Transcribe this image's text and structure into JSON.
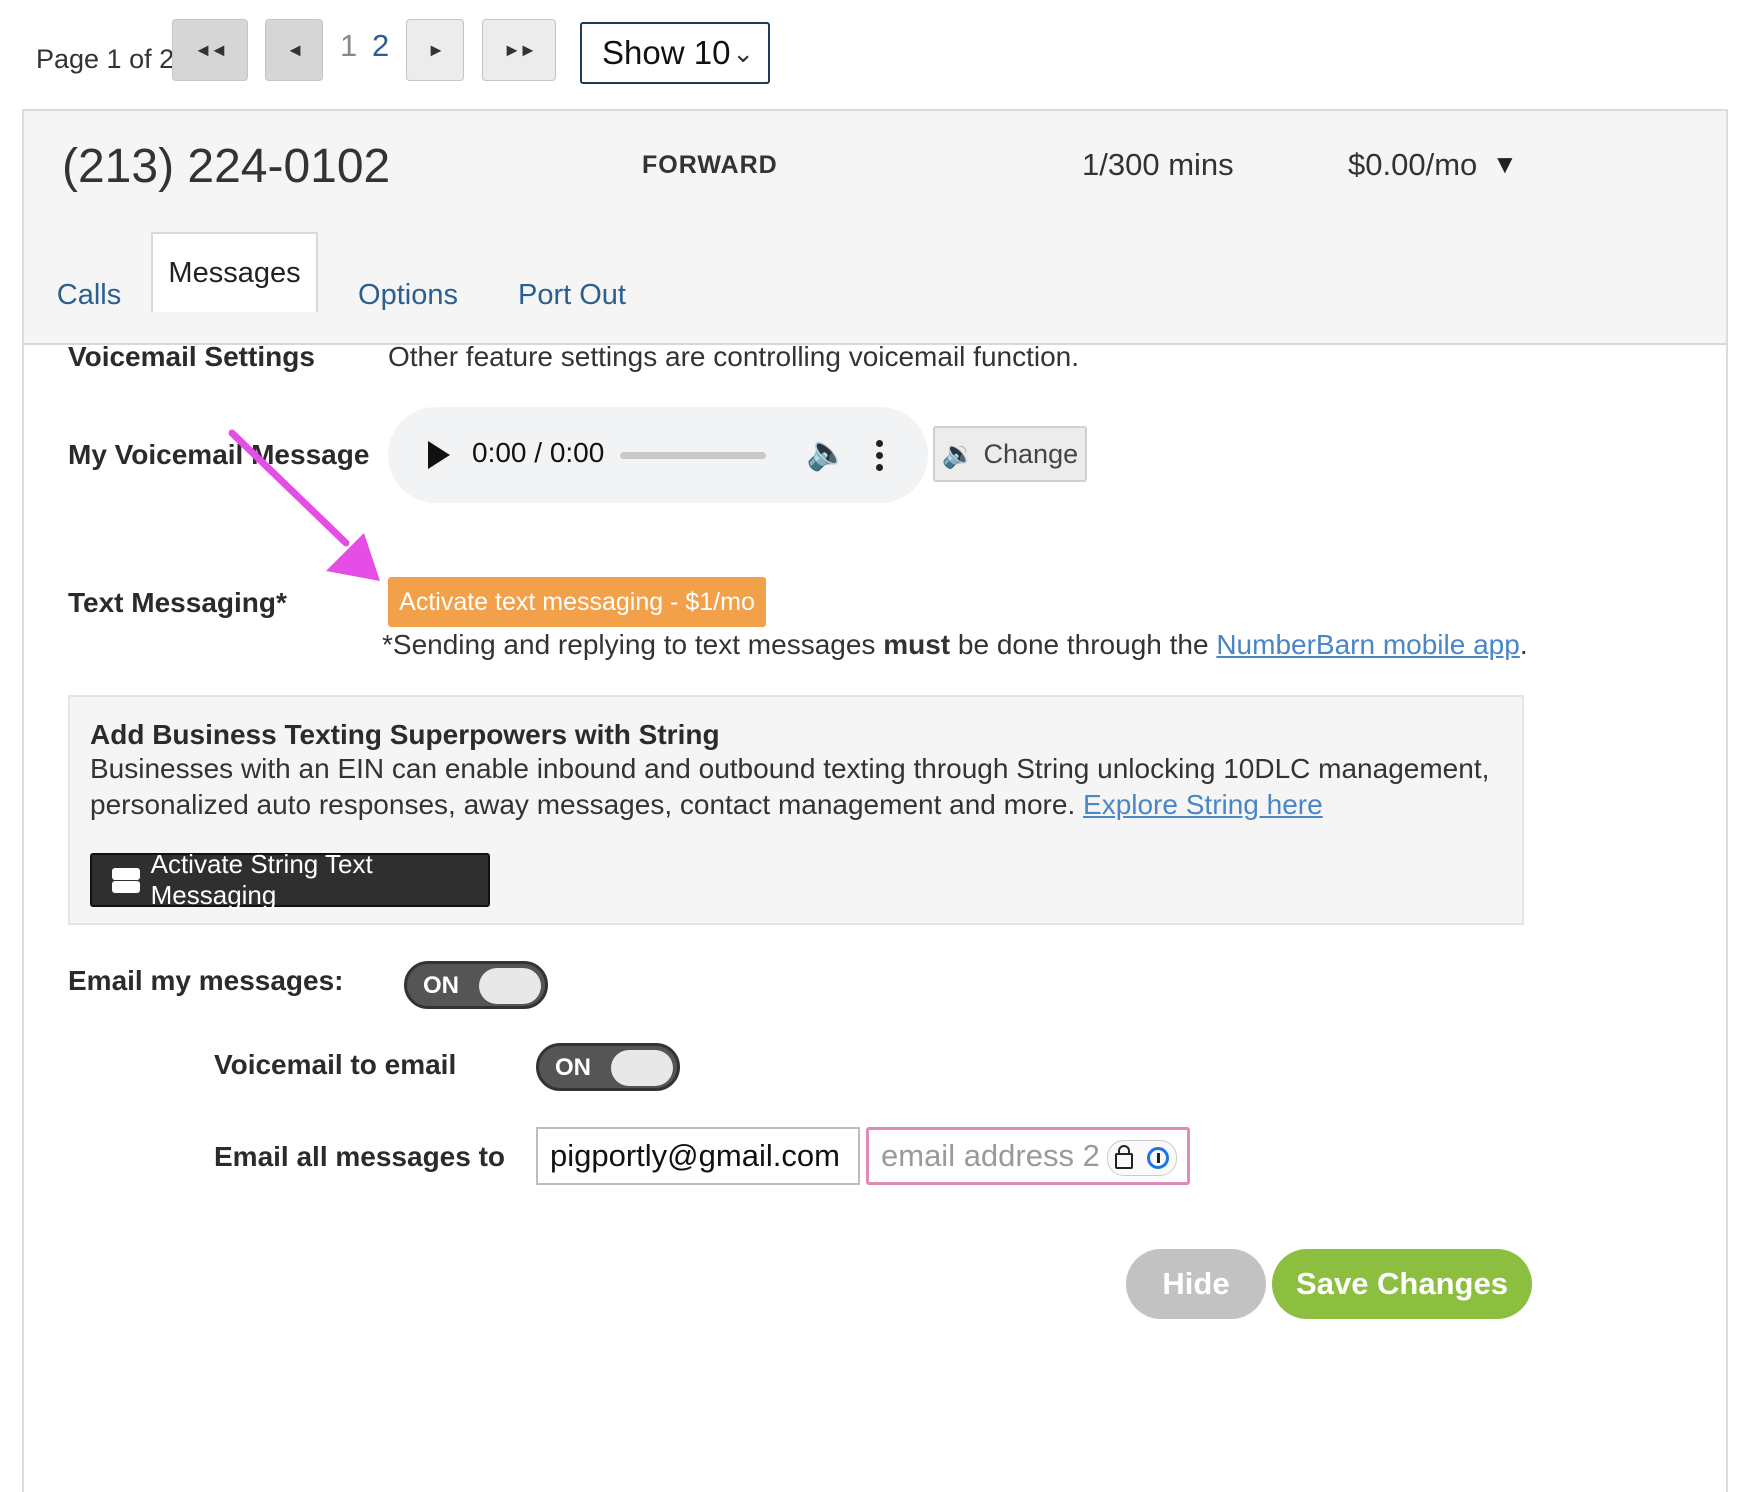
{
  "pagination": {
    "page_info": "Page 1 of 2",
    "first_label": "◄◄",
    "prev_label": "◄",
    "page1": "1",
    "page2": "2",
    "next_label": "►",
    "last_label": "►►",
    "show_select": "Show 10"
  },
  "number": {
    "phone": "(213) 224-0102",
    "mode": "FORWARD",
    "usage": "1/300 mins",
    "price": "$0.00/mo",
    "caret": "▼"
  },
  "tabs": [
    "Calls",
    "Messages",
    "Options",
    "Port Out"
  ],
  "voicemail": {
    "settings_label": "Voicemail Settings",
    "settings_text": "Other feature settings are controlling voicemail function.",
    "message_label": "My Voicemail Message",
    "player_time": "0:00 / 0:00",
    "change_label": "Change"
  },
  "text_messaging": {
    "label": "Text Messaging*",
    "activate_label": "Activate text messaging - $1/mo",
    "note_prefix": "*Sending and replying to text messages ",
    "note_bold": "must",
    "note_middle": " be done through the ",
    "note_link": "NumberBarn mobile app",
    "note_suffix": "."
  },
  "string_box": {
    "heading": "Add Business Texting Superpowers with String",
    "body": "Businesses with an EIN can enable inbound and outbound texting through String unlocking 10DLC management, personalized auto responses, away messages, contact management and more. ",
    "link": "Explore String here",
    "button_label": "Activate String Text Messaging"
  },
  "email": {
    "email_label": "Email my messages:",
    "email_toggle": "ON",
    "vm_label": "Voicemail to email",
    "vm_toggle": "ON",
    "all_label": "Email all messages to",
    "email1_value": "pigportly@gmail.com",
    "email2_placeholder": "email address 2"
  },
  "actions": {
    "hide": "Hide",
    "save": "Save Changes"
  },
  "colors": {
    "activate_orange": "#f2a14a",
    "save_green": "#8cbf3f",
    "link_blue": "#2a5f8f",
    "annotation_arrow": "#e64ce6"
  }
}
